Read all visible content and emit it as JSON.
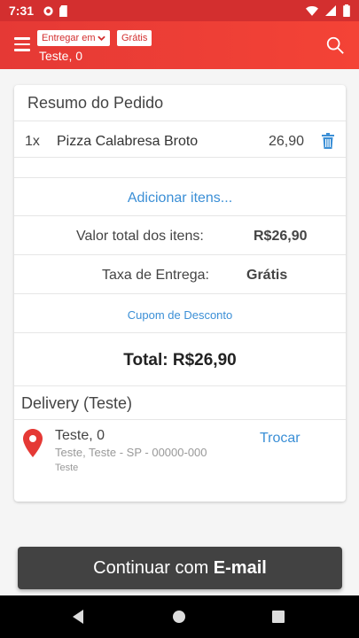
{
  "status_bar": {
    "time": "7:31"
  },
  "appbar": {
    "deliver_chip": "Entregar em",
    "free_chip": "Grátis",
    "address": "Teste, 0"
  },
  "order": {
    "title": "Resumo do Pedido",
    "items": [
      {
        "qty": "1x",
        "name": "Pizza Calabresa Broto",
        "price": "26,90"
      }
    ],
    "add_items": "Adicionar itens...",
    "items_total_label": "Valor total dos itens:",
    "items_total_value": "R$26,90",
    "fee_label": "Taxa de Entrega:",
    "fee_value": "Grátis",
    "coupon": "Cupom de Desconto",
    "grand_total": "Total: R$26,90"
  },
  "delivery": {
    "title": "Delivery (Teste)",
    "name": "Teste, 0",
    "line": "Teste, Teste - SP - 00000-000",
    "sub": "Teste",
    "change": "Trocar"
  },
  "cta": {
    "prefix": "Continuar com ",
    "bold": "E-mail"
  },
  "colors": {
    "primary": "#e53935",
    "link": "#3b8fd6",
    "cta": "#424242"
  }
}
